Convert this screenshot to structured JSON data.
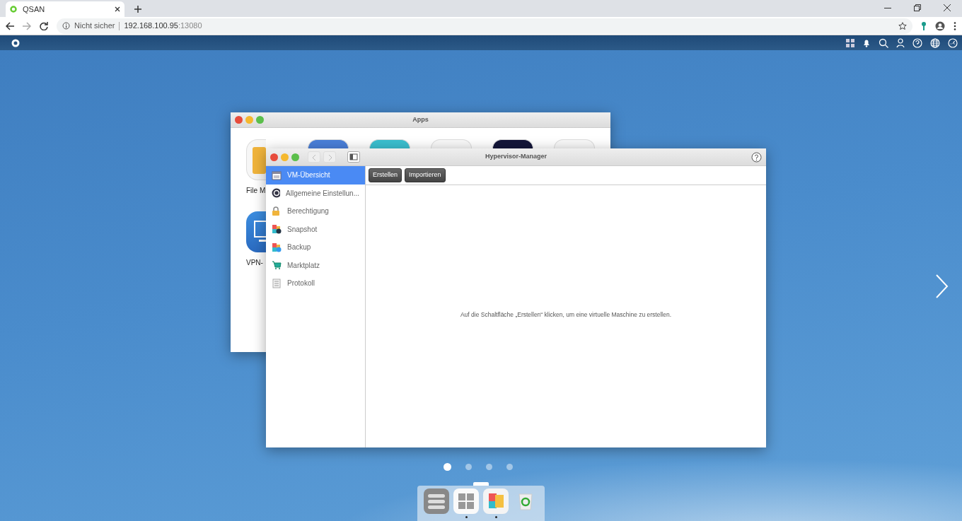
{
  "browser": {
    "tab_title": "QSAN",
    "security_label": "Nicht sicher",
    "host": "192.168.100.95",
    "port": ":13080"
  },
  "apps_window": {
    "title": "Apps",
    "apps": [
      {
        "label": "File M"
      },
      {
        "label": "VPN-"
      }
    ]
  },
  "hypervisor_window": {
    "title": "Hypervisor-Manager",
    "sidebar": [
      {
        "kind": "overview",
        "label": "VM-Übersicht",
        "selected": true
      },
      {
        "kind": "settings",
        "label": "Allgemeine Einstellun...",
        "selected": false
      },
      {
        "kind": "permission",
        "label": "Berechtigung",
        "selected": false
      },
      {
        "kind": "snapshot",
        "label": "Snapshot",
        "selected": false
      },
      {
        "kind": "backup",
        "label": "Backup",
        "selected": false
      },
      {
        "kind": "market",
        "label": "Marktplatz",
        "selected": false
      },
      {
        "kind": "log",
        "label": "Protokoll",
        "selected": false
      }
    ],
    "buttons": [
      "Erstellen",
      "Importieren"
    ],
    "empty_message": "Auf die Schaltfläche „Erstellen“ klicken, um eine virtuelle Maschine zu erstellen."
  },
  "page_dots": [
    {
      "selected": true
    },
    {
      "selected": false
    },
    {
      "selected": false
    },
    {
      "selected": false
    }
  ],
  "dock": [
    {
      "kind": "control",
      "running": false
    },
    {
      "kind": "apps",
      "running": true
    },
    {
      "kind": "hypervisor",
      "running": true
    },
    {
      "kind": "trash",
      "running": false
    }
  ]
}
